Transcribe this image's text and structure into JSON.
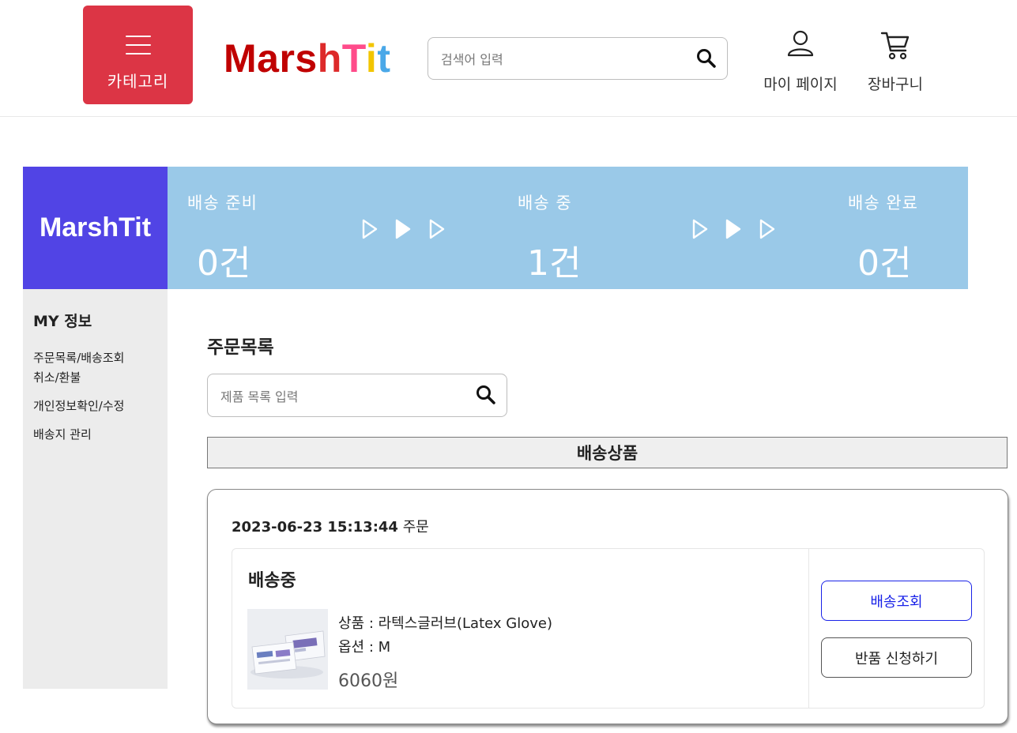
{
  "header": {
    "category_label": "카테고리",
    "logo": {
      "part1": "Mars",
      "part2": "h",
      "part3": "T",
      "part4": "i",
      "part5": "t"
    },
    "search_placeholder": "검색어 입력",
    "mypage_label": "마이 페이지",
    "cart_label": "장바구니"
  },
  "status_band": {
    "brand": "MarshTit",
    "stages": [
      {
        "label": "배송 준비",
        "count": "0건"
      },
      {
        "label": "배송 중",
        "count": "1건"
      },
      {
        "label": "배송 완료",
        "count": "0건"
      }
    ]
  },
  "sidebar": {
    "title": "MY 정보",
    "items": [
      {
        "label": "주문목록/배송조회"
      },
      {
        "label": "취소/환불"
      },
      {
        "label": "개인정보확인/수정"
      },
      {
        "label": "배송지 관리"
      }
    ]
  },
  "main": {
    "section_title": "주문목록",
    "search_placeholder": "제품 목록 입력",
    "tab_label": "배송상품",
    "order": {
      "datetime": "2023-06-23 15:13:44",
      "date_suffix": "주문",
      "status": "배송중",
      "product": "상품 : 라텍스글러브(Latex Glove)",
      "option": "옵션 : M",
      "price": "6060원",
      "track_button": "배송조회",
      "return_button": "반품 신청하기"
    }
  },
  "colors": {
    "category_button": "#dc3545",
    "brand_box": "#5144e5",
    "status_band": "#9ac9e8",
    "sidebar_bg": "#ececec",
    "track_button": "#1a23e8"
  }
}
